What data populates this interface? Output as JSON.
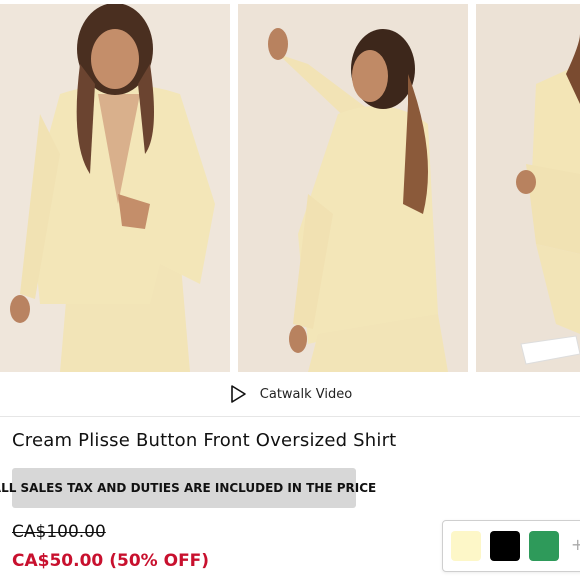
{
  "gallery": {
    "photos": [
      {
        "icon": "photo-front-model"
      },
      {
        "icon": "photo-side-model"
      },
      {
        "icon": "photo-seated-model"
      }
    ]
  },
  "catwalk": {
    "label": "Catwalk Video",
    "icon": "play-icon"
  },
  "product": {
    "title": "Cream Plisse Button Front Oversized Shirt",
    "tax_notice": "ALL SALES TAX AND DUTIES ARE INCLUDED IN THE PRICE",
    "original_price": "CA$100.00",
    "sale_price": "CA$50.00",
    "discount": "(50% OFF)"
  },
  "colors": {
    "sale_red": "#c8102e",
    "banner_gray": "#d7d7d7",
    "swatches": [
      {
        "name": "cream",
        "hex": "#fdf7c8"
      },
      {
        "name": "black",
        "hex": "#000000"
      },
      {
        "name": "green",
        "hex": "#2e9a5a"
      }
    ],
    "more_symbol": "+"
  }
}
